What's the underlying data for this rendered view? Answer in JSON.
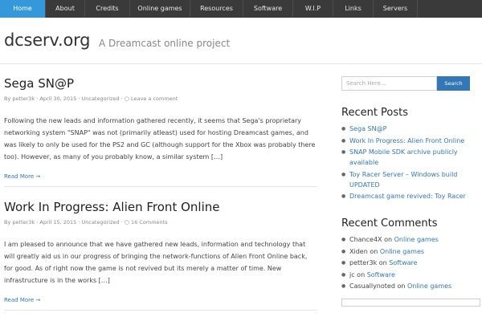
{
  "nav": {
    "items": [
      {
        "label": "Home",
        "active": true
      },
      {
        "label": "About"
      },
      {
        "label": "Credits"
      },
      {
        "label": "Online games"
      },
      {
        "label": "Resources"
      },
      {
        "label": "Software"
      },
      {
        "label": "W.I.P"
      },
      {
        "label": "Links"
      },
      {
        "label": "Servers"
      }
    ]
  },
  "header": {
    "title": "dcserv.org",
    "tagline": "A Dreamcast online project"
  },
  "posts": [
    {
      "title": "Sega SN@P",
      "by": "By",
      "author": "petter3k",
      "date": "April 30, 2015",
      "category": "Uncategorized",
      "comments": "Leave a comment",
      "excerpt": "Following the new leads and information gathered recently, it seems that Sega's proprietary networking system \"SNAP\" was not (primarily atleast) used for hosting Dreamcast games, and was likely to only be used for the PS2 and GC (although support for the Xbox was probably there too). However, as many of you probably know, a similar system […]",
      "read_more": "Read More →"
    },
    {
      "title": "Work In Progress: Alien Front Online",
      "by": "By",
      "author": "petter3k",
      "date": "April 15, 2015",
      "category": "Uncategorized",
      "comments": "16 Comments",
      "excerpt": "I am pleased to announce that we have gathered new leads, information and technology that will greatly aid us in our progress of bringing the network-functions of Alien Front Online back, for good. As of right now the game is not revived but its merely a matter of time. New infrastructure is in the works […]",
      "read_more": "Read More →"
    }
  ],
  "sidebar": {
    "search": {
      "placeholder": "Search Here...",
      "button": "Search"
    },
    "recent_posts": {
      "title": "Recent Posts",
      "items": [
        "Sega SN@P",
        "Work In Progress: Alien Front Online",
        "SNAP Mobile SDK archive publicly available",
        "Toy Racer Server – Windows build UPDATED",
        "Dreamcast game revived: Toy Racer"
      ]
    },
    "recent_comments": {
      "title": "Recent Comments",
      "on": "on",
      "items": [
        {
          "author": "Chance4X",
          "post": "Online games"
        },
        {
          "author": "Xiden",
          "post": "Online games"
        },
        {
          "author": "petter3k",
          "post": "Software"
        },
        {
          "author": "jc",
          "post": "Software"
        },
        {
          "author": "Casuallynoted",
          "post": "Online games"
        }
      ]
    }
  },
  "colors": {
    "accent": "#3498db",
    "link": "#3277b7",
    "nav_bg": "#3a3a3a"
  }
}
